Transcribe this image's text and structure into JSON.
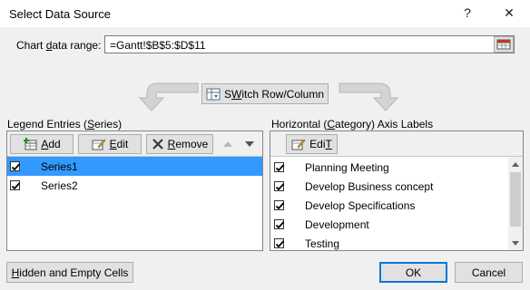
{
  "window": {
    "title": "Select Data Source",
    "help_label": "?",
    "close_label": "✕"
  },
  "range": {
    "label_prefix": "Chart ",
    "label_u": "d",
    "label_suffix": "ata range:",
    "value": "=Gantt!$B$5:$D$11"
  },
  "switch_button": {
    "u": "W",
    "rest_prefix": "S",
    "rest_suffix": "itch Row/Column"
  },
  "legend": {
    "header_prefix": "Legend Entries (",
    "header_u": "S",
    "header_suffix": "eries)",
    "add_u": "A",
    "add_rest": "dd",
    "edit_u": "E",
    "edit_rest": "dit",
    "remove_u": "R",
    "remove_rest": "emove",
    "items": [
      {
        "label": "Series1",
        "checked": true,
        "selected": true
      },
      {
        "label": "Series2",
        "checked": true,
        "selected": false
      }
    ]
  },
  "axis": {
    "header_prefix": "Horizontal (",
    "header_u": "C",
    "header_suffix": "ategory) Axis Labels",
    "edit_u": "T",
    "edit_label_prefix": "Edi",
    "items": [
      {
        "label": "Planning Meeting",
        "checked": true
      },
      {
        "label": "Develop Business concept",
        "checked": true
      },
      {
        "label": "Develop Specifications",
        "checked": true
      },
      {
        "label": "Development",
        "checked": true
      },
      {
        "label": "Testing",
        "checked": true
      }
    ]
  },
  "footer": {
    "hidden_u": "H",
    "hidden_rest": "idden and Empty Cells",
    "ok_label": "OK",
    "cancel_label": "Cancel"
  },
  "colors": {
    "accent": "#0078d7",
    "selection": "#3399ff"
  }
}
